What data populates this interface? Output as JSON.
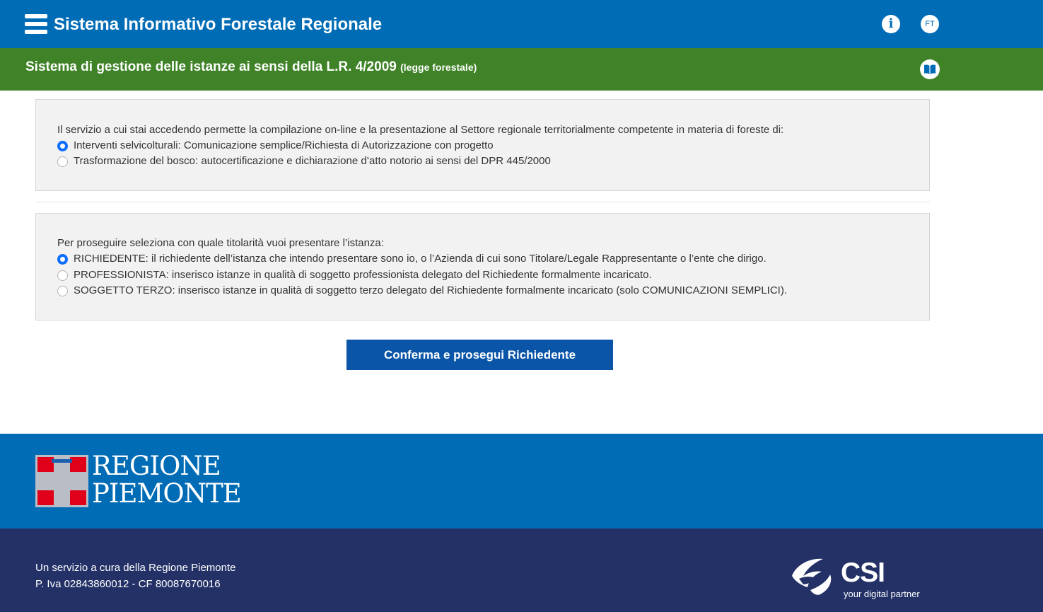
{
  "header": {
    "title": "Sistema Informativo Forestale Regionale",
    "menu_icon": "hamburger-menu-icon",
    "info_icon_glyph": "i",
    "user_initials": "FT",
    "background_color": "#006cb6"
  },
  "subheader": {
    "title": "Sistema di gestione delle istanze ai sensi della L.R. 4/2009",
    "title_suffix": "(legge forestale)",
    "manual_icon": "book-open-icon",
    "background_color": "#3f8227"
  },
  "service_panel": {
    "intro": "Il servizio a cui stai accedendo permette la compilazione on-line e la presentazione al Settore regionale territorialmente competente in materia di foreste di:",
    "options": [
      {
        "label": "Interventi selvicolturali: Comunicazione semplice/Richiesta di Autorizzazione con progetto",
        "selected": true
      },
      {
        "label": "Trasformazione del bosco: autocertificazione e dichiarazione d’atto notorio ai sensi del DPR 445/2000",
        "selected": false
      }
    ]
  },
  "role_panel": {
    "intro": "Per proseguire seleziona con quale titolarità vuoi presentare l’istanza:",
    "options": [
      {
        "label": "RICHIEDENTE: il richiedente dell’istanza che intendo presentare sono io, o l’Azienda di cui sono Titolare/Legale Rappresentante o l’ente che dirigo.",
        "selected": true
      },
      {
        "label": "PROFESSIONISTA: inserisco istanze in qualità di soggetto professionista delegato del Richiedente formalmente incaricato.",
        "selected": false
      },
      {
        "label": "SOGGETTO TERZO: inserisco istanze in qualità di soggetto terzo delegato del Richiedente formalmente incaricato (solo COMUNICAZIONI SEMPLICI).",
        "selected": false
      }
    ]
  },
  "confirm_button": {
    "label": "Conferma e prosegui Richiedente",
    "color": "#0a55a8"
  },
  "footer": {
    "region_logo_line1": "REGIONE",
    "region_logo_line2": "PIEMONTE",
    "service_line": "Un servizio a cura della Regione Piemonte",
    "tax_line": "P. Iva 02843860012 - CF 80087670016",
    "csi_name": "CSI",
    "csi_tagline": "your digital partner",
    "blue_color": "#006cb6",
    "dark_color": "#233167"
  }
}
